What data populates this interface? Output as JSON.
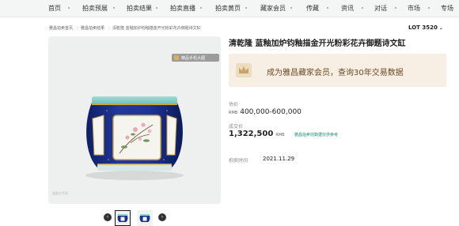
{
  "nav": {
    "items": [
      "首页",
      "拍卖预展",
      "拍卖结果",
      "拍卖直播",
      "拍卖黄页",
      "藏家会员",
      "传藏",
      "资讯",
      "对话",
      "市场",
      "专场"
    ]
  },
  "breadcrumb": [
    "雅昌拍卖首页",
    "雅昌拍卖结果",
    "清乾隆 蓝釉加炉钧釉描金开光粉彩花卉御题诗文缸"
  ],
  "lot": {
    "label": "LOT 3520"
  },
  "image_badge": {
    "text": "精品手机大图"
  },
  "watermark": "雅昌艺术网",
  "item": {
    "title": "清乾隆 蓝釉加炉钧釉描金开光粉彩花卉御题诗文缸",
    "vip_text": "成为雅昌藏家会员，查询30年交易数据",
    "estimate_label": "估价",
    "currency": "RMB",
    "estimate": "400,000-600,000",
    "hammer_label": "成交价",
    "hammer_price": "1,322,500",
    "hammer_note": "雅昌拍卖前数据仅供参考",
    "date_label": "拍卖时间",
    "date": "2021.11.29"
  },
  "colors": {
    "vip_bg": "#f8efe4",
    "vip_text": "#6a4a22",
    "note": "#1a8a7a",
    "jar_blue": "#1a2f8f",
    "jar_rim": "#8ed3cc"
  }
}
